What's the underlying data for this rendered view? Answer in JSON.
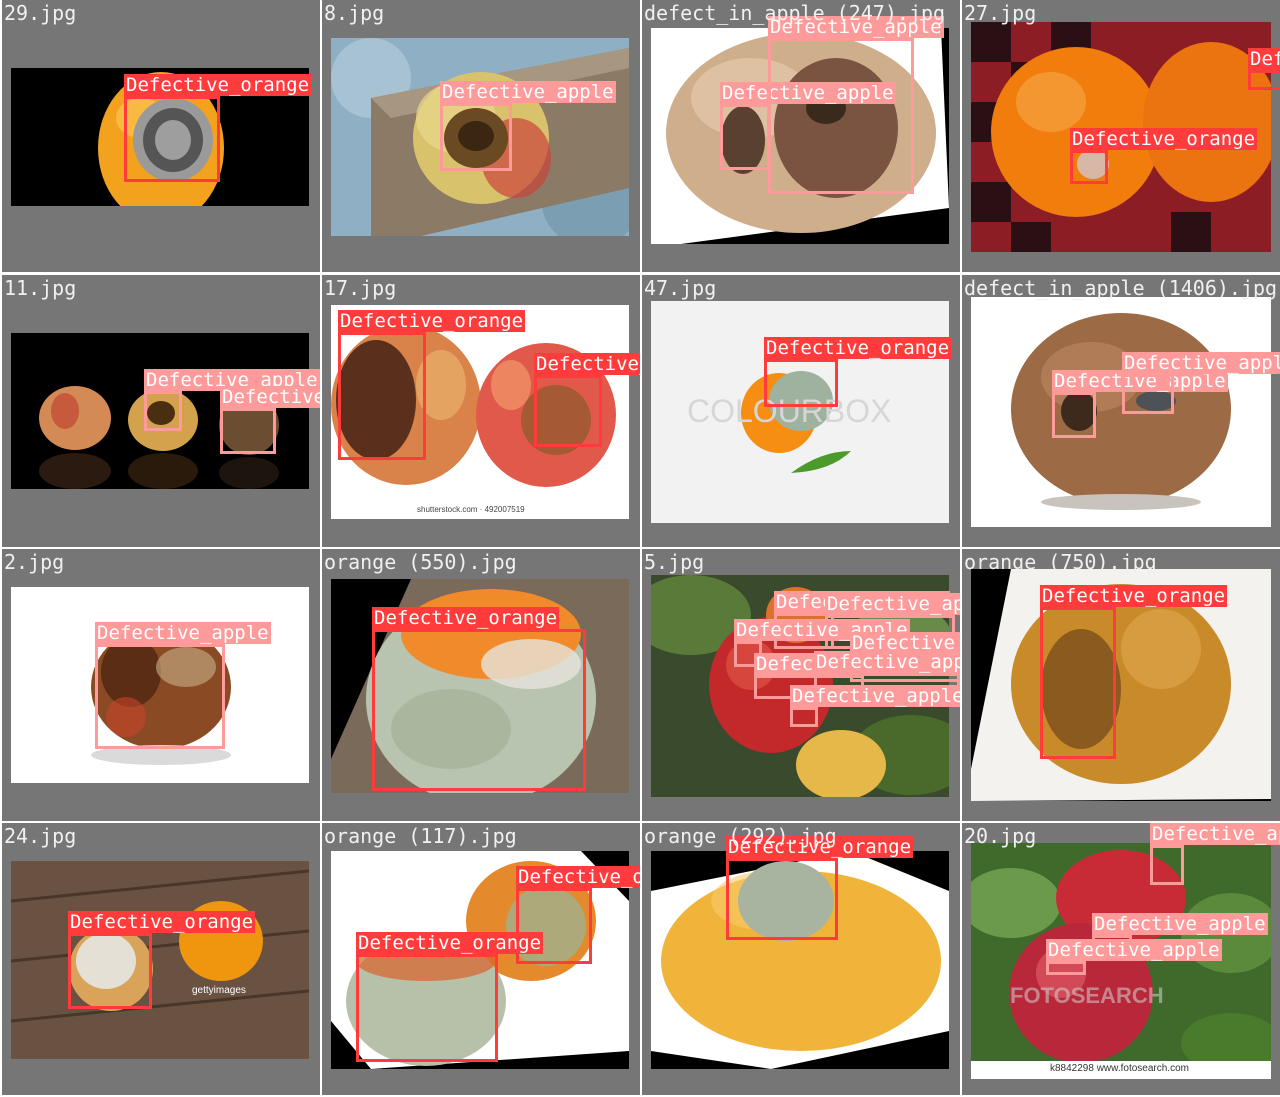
{
  "tiles": [
    {
      "name": "29.jpg"
    },
    {
      "name": "8.jpg"
    },
    {
      "name": "defect_in_apple (247).jpg"
    },
    {
      "name": "27.jpg"
    },
    {
      "name": "11.jpg"
    },
    {
      "name": "17.jpg"
    },
    {
      "name": "47.jpg"
    },
    {
      "name": "defect_in_apple (1406).jpg"
    },
    {
      "name": "2.jpg"
    },
    {
      "name": "orange (550).jpg"
    },
    {
      "name": "5.jpg"
    },
    {
      "name": "orange (750).jpg"
    },
    {
      "name": "24.jpg"
    },
    {
      "name": "orange (117).jpg"
    },
    {
      "name": "orange (292).jpg"
    },
    {
      "name": "20.jpg"
    }
  ],
  "labels": {
    "orange": "Defective_orange",
    "apple": "Defective_apple"
  },
  "watermarks": {
    "shutterstock": "shutterstock.com · 492007519",
    "colourbox": "COLOURBOX",
    "getty": "gettyimages",
    "fotosearch_mark": "FOTOSEARCH",
    "fotosearch_caption": "k8842298  www.fotosearch.com"
  },
  "colors": {
    "orange_box": "#ff3b3b",
    "apple_box": "#ff9a9a",
    "tile_background": "#767676",
    "title_text": "#f0f0f0"
  }
}
